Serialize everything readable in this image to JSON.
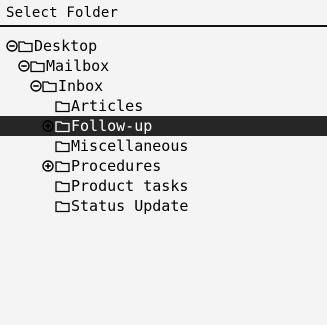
{
  "window": {
    "title": "Select Folder"
  },
  "tree": {
    "items": [
      {
        "label": "Desktop",
        "expander": "minus",
        "level": 0
      },
      {
        "label": "Mailbox",
        "expander": "minus",
        "level": 1
      },
      {
        "label": "Inbox",
        "expander": "minus",
        "level": 2
      },
      {
        "label": "Articles",
        "expander": "none",
        "level": 3
      },
      {
        "label": "Follow-up",
        "expander": "plus",
        "level": 3,
        "selected": true
      },
      {
        "label": "Miscellaneous",
        "expander": "none",
        "level": 3
      },
      {
        "label": "Procedures",
        "expander": "plus",
        "level": 3
      },
      {
        "label": "Product tasks",
        "expander": "none",
        "level": 3
      },
      {
        "label": "Status Update",
        "expander": "none",
        "level": 3
      }
    ]
  },
  "icons": {
    "folder": "folder-icon",
    "expanded": "minus-circle-icon",
    "collapsed": "plus-circle-icon"
  },
  "colors": {
    "background": "#f4f4f4",
    "selection": "#262626",
    "text": "#000000",
    "selected_text": "#ffffff"
  }
}
